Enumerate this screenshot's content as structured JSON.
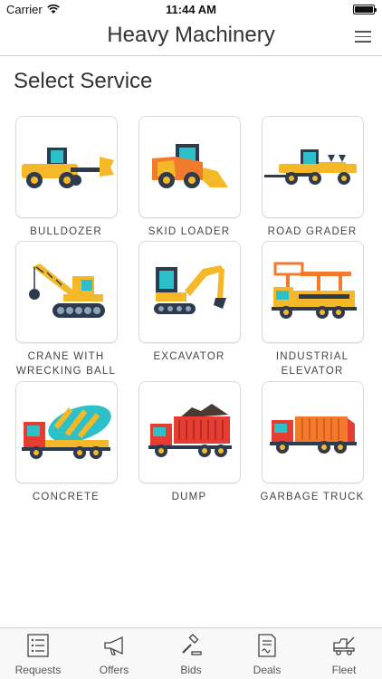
{
  "status": {
    "carrier": "Carrier",
    "time": "11:44 AM"
  },
  "nav": {
    "title": "Heavy Machinery"
  },
  "page": {
    "section_title": "Select Service"
  },
  "services": [
    {
      "label": "BULLDOZER",
      "icon": "bulldozer-icon"
    },
    {
      "label": "SKID LOADER",
      "icon": "skid-loader-icon"
    },
    {
      "label": "ROAD GRADER",
      "icon": "road-grader-icon"
    },
    {
      "label": "CRANE WITH WRECKING BALL",
      "icon": "crane-icon"
    },
    {
      "label": "EXCAVATOR",
      "icon": "excavator-icon"
    },
    {
      "label": "INDUSTRIAL ELEVATOR",
      "icon": "industrial-elevator-icon"
    },
    {
      "label": "CONCRETE",
      "icon": "concrete-mixer-icon"
    },
    {
      "label": "DUMP",
      "icon": "dump-truck-icon"
    },
    {
      "label": "GARBAGE TRUCK",
      "icon": "garbage-truck-icon"
    }
  ],
  "tabs": [
    {
      "label": "Requests",
      "icon": "list-icon"
    },
    {
      "label": "Offers",
      "icon": "megaphone-icon"
    },
    {
      "label": "Bids",
      "icon": "gavel-icon"
    },
    {
      "label": "Deals",
      "icon": "document-icon"
    },
    {
      "label": "Fleet",
      "icon": "tow-truck-icon"
    }
  ],
  "colors": {
    "yellow": "#f5b829",
    "orange": "#f27a2c",
    "red": "#e53d32",
    "dark": "#2e3a4d",
    "teal": "#2ec0c8",
    "border": "#dadada"
  }
}
